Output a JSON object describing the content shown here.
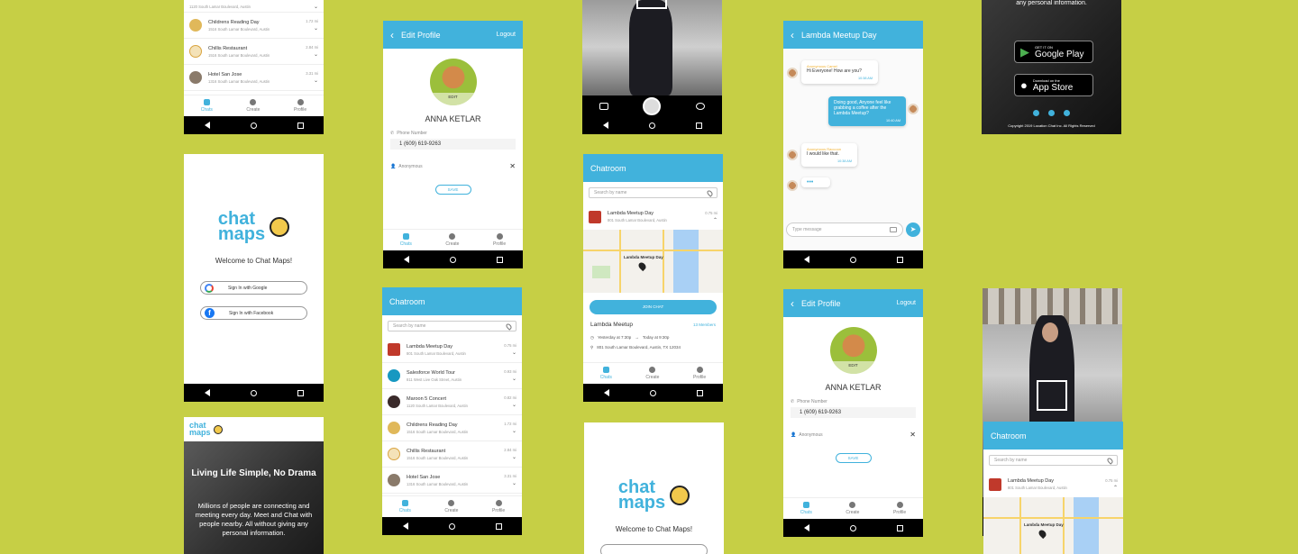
{
  "colors": {
    "background": "#c6cf45",
    "accent": "#41b2dc"
  },
  "tabs": {
    "chats": "Chats",
    "create": "Create",
    "profile": "Profile"
  },
  "list_items": [
    {
      "title": "Lambda Meetup Day",
      "subtitle": "801 South Lamar Boulevard, Austin",
      "distance": "0.75 mi",
      "avatar": "lambda-logo"
    },
    {
      "title": "Salesforce World Tour",
      "subtitle": "811 West Live Oak Street, Austin",
      "distance": "0.93 mi",
      "avatar": "salesforce-logo"
    },
    {
      "title": "Maroon 5 Concert",
      "subtitle": "1120 South Lamar Boulevard, Austin",
      "distance": "0.82 mi",
      "avatar": "band-photo"
    },
    {
      "title": "Childrens Reading Day",
      "subtitle": "1516 South Lamar Boulevard, Austin",
      "distance": "1.72 mi",
      "avatar": "kids-photo"
    },
    {
      "title": "Chillis Restaurant",
      "subtitle": "1516 South Lamar Boulevard, Austin",
      "distance": "2.84 mi",
      "avatar": "chillis-logo"
    },
    {
      "title": "Hotel San Jose",
      "subtitle": "1316 South Lamar Boulevard, Austin",
      "distance": "3.31 mi",
      "avatar": "hotel-photo"
    }
  ],
  "top_list": {
    "first_sub": "1120 South Lamar Boulevard, Austin"
  },
  "profile": {
    "header": "Edit Profile",
    "logout": "Logout",
    "edit": "EDIT",
    "name": "ANNA KETLAR",
    "phone_label": "Phone Number",
    "phone": "1 (609) 619-9263",
    "anonymous": "Anonymous",
    "save": "SAVE"
  },
  "signin": {
    "logo_line1": "chat",
    "logo_line2": "maps",
    "welcome": "Welcome to Chat Maps!",
    "google": "Sign In with Google",
    "facebook": "Sign In with Facebook"
  },
  "landing": {
    "headline": "Living Life Simple, No Drama",
    "body": "Millions of people are connecting and meeting every day. Meet and Chat with people nearby. All without giving any personal information.",
    "body_tail": "any personal information.",
    "google_play_small": "GET IT ON",
    "google_play": "Google Play",
    "app_store_small": "Download on the",
    "app_store": "App Store",
    "copyright": "Copyright 2019 Location Chat Inc. All Rights Reserved"
  },
  "chatroom": {
    "header": "Chatroom",
    "search_placeholder": "Search by name",
    "event": "Lambda Meetup Day",
    "event_address": "801 South Lamar Boulevard, Austin",
    "distance": "0.75 mi",
    "map_label": "Lambda Meetup Day",
    "join": "JOIN CHAT",
    "detail_title": "Lambda Meetup",
    "members": "13 Members",
    "time_start": "Yesterday at 7:30p",
    "time_end": "Today at 9:30p",
    "address_full": "801 South Lamar Boulevard, Austin, TX 12034"
  },
  "chat": {
    "header": "Lambda Meetup Day",
    "msg1_name": "Anonymous Camel",
    "msg1": "Hi Everyone! How are you?",
    "msg1_time": "10:38 AM",
    "msg2": "Doing good, Anyone feel like grabbing a coffee after the Lambda Meetup?",
    "msg2_time": "10:40 AM",
    "msg3_name": "Anonymous Raccoon",
    "msg3": "I would like that.",
    "msg3_time": "10:38 AM",
    "typing": "•••",
    "input_placeholder": "Type message"
  }
}
